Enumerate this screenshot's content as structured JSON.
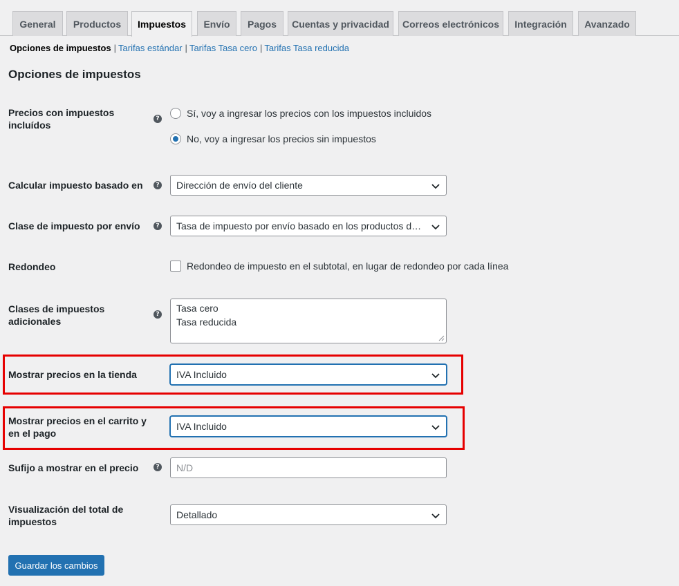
{
  "tabs": [
    {
      "label": "General"
    },
    {
      "label": "Productos"
    },
    {
      "label": "Impuestos",
      "active": true
    },
    {
      "label": "Envío"
    },
    {
      "label": "Pagos"
    },
    {
      "label": "Cuentas y privacidad"
    },
    {
      "label": "Correos electrónicos"
    },
    {
      "label": "Integración"
    },
    {
      "label": "Avanzado"
    }
  ],
  "subnav": {
    "current": "Opciones de impuestos",
    "separator": "|",
    "links": [
      "Tarifas estándar",
      "Tarifas Tasa cero",
      "Tarifas Tasa reducida"
    ]
  },
  "section_title": "Opciones de impuestos",
  "help_icon_glyph": "?",
  "fields": {
    "prices_include_tax": {
      "label_line1": "Precios con impuestos",
      "label_line2": "incluídos",
      "options": [
        {
          "label": "Sí, voy a ingresar los precios con los impuestos incluidos",
          "checked": false
        },
        {
          "label": "No, voy a ingresar los precios sin impuestos",
          "checked": true
        }
      ]
    },
    "tax_based_on": {
      "label": "Calcular impuesto basado en",
      "value": "Dirección de envío del cliente"
    },
    "shipping_tax_class": {
      "label": "Clase de impuesto por envío",
      "value": "Tasa de impuesto por envío basado en los productos del carrito"
    },
    "rounding": {
      "label": "Redondeo",
      "checkbox_label": "Redondeo de impuesto en el subtotal, en lugar de redondeo por cada línea",
      "checked": false
    },
    "additional_classes": {
      "label_line1": "Clases de impuestos",
      "label_line2": "adicionales",
      "lines": [
        "Tasa cero",
        "Tasa reducida"
      ]
    },
    "display_shop": {
      "label": "Mostrar precios en la tienda",
      "value": "IVA Incluido"
    },
    "display_cart": {
      "label_line1": "Mostrar precios en el carrito y",
      "label_line2": "en el pago",
      "value": "IVA Incluido"
    },
    "price_suffix": {
      "label": "Sufijo a mostrar en el precio",
      "placeholder": "N/D"
    },
    "total_display": {
      "label_line1": "Visualización del total de",
      "label_line2": "impuestos",
      "value": "Detallado"
    }
  },
  "save_button": "Guardar los cambios",
  "colors": {
    "highlight": "#e60000",
    "primary": "#2271b1",
    "background": "#f0f0f1"
  }
}
